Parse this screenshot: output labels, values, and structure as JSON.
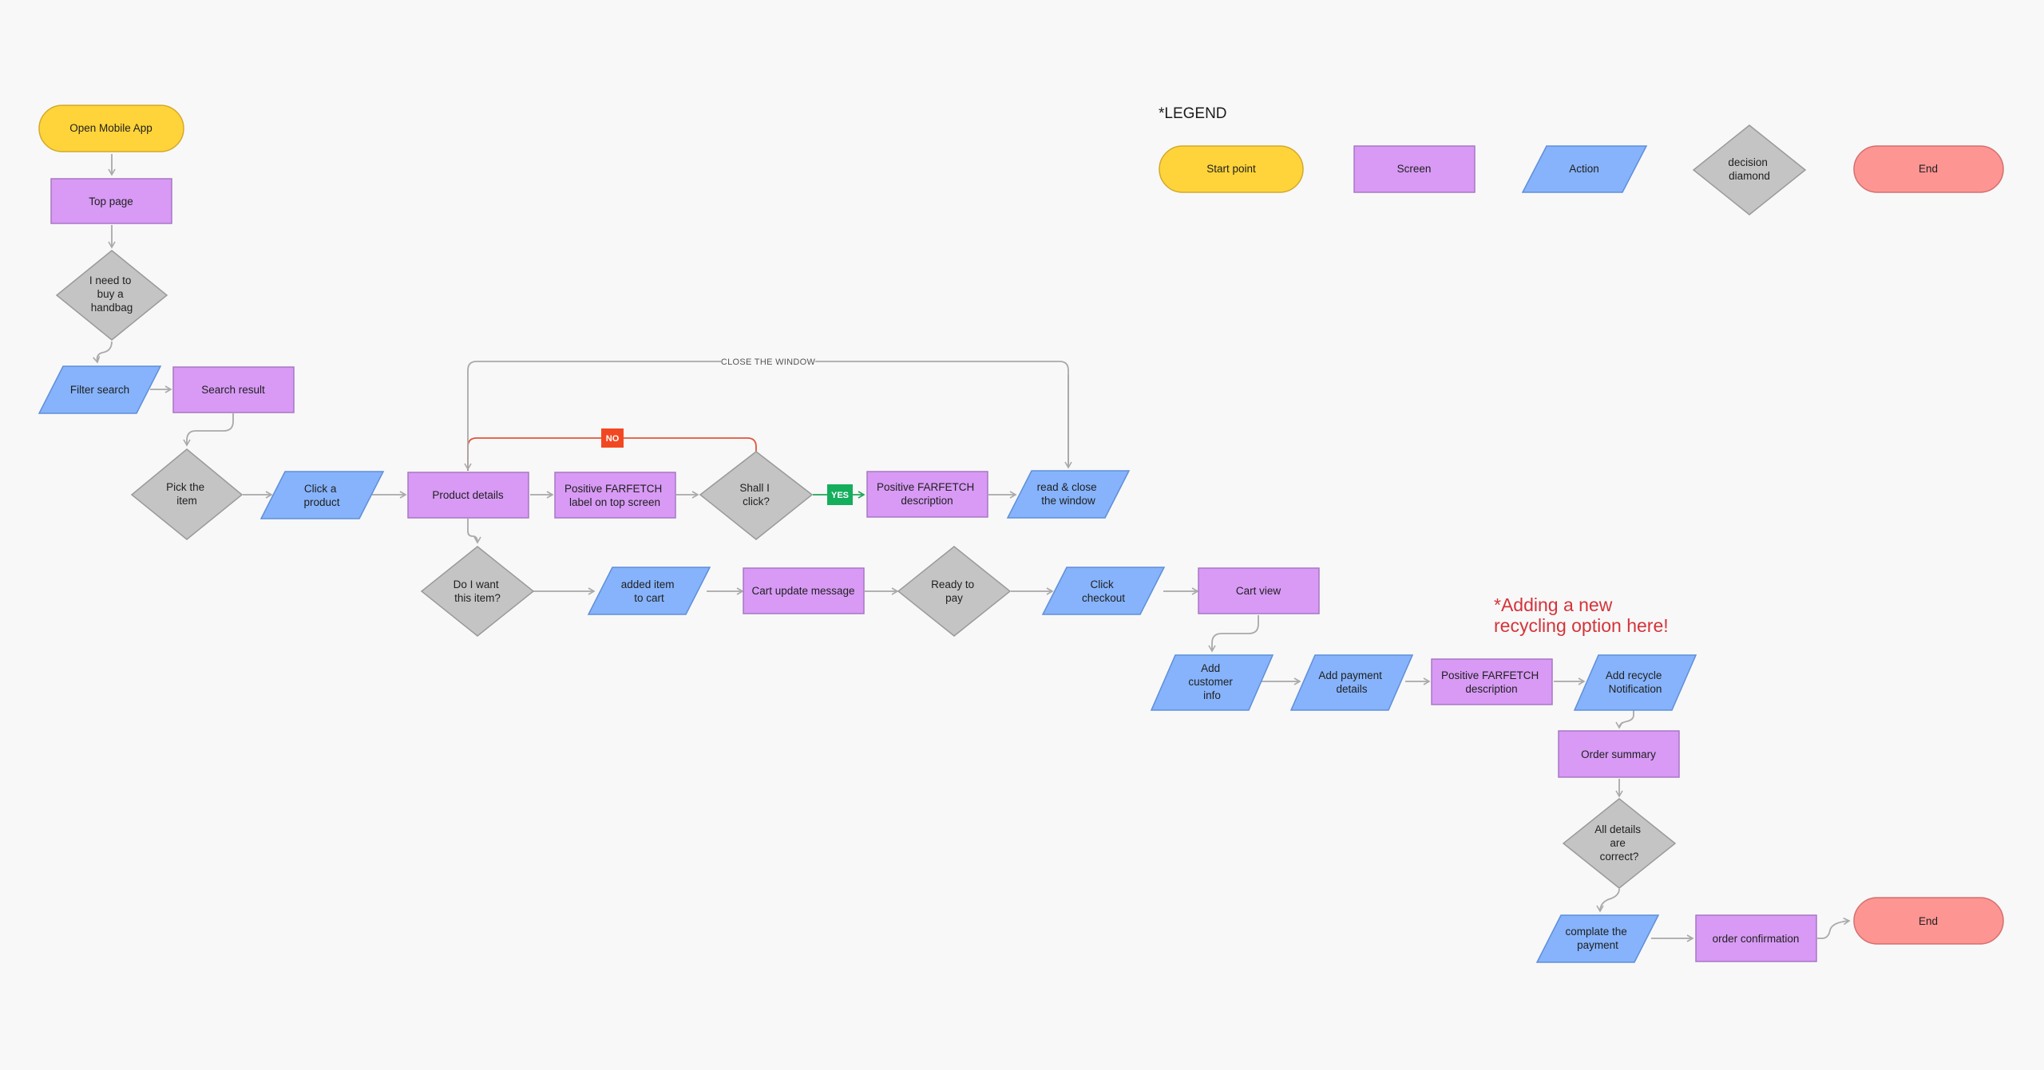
{
  "legend": {
    "title": "*LEGEND",
    "start": "Start point",
    "screen": "Screen",
    "action": "Action",
    "decision": "decision diamond",
    "end": "End"
  },
  "note": {
    "line1": "*Adding a new",
    "line2": "recycling option here!"
  },
  "colors": {
    "start": "#ffd43a",
    "screen": "#d89af5",
    "action": "#86b3fb",
    "decision": "#c4c4c4",
    "end": "#fd9593",
    "no_tag": "#f24822",
    "yes_tag": "#14ae5c",
    "note": "#d4343a"
  },
  "nodes": {
    "open_app": "Open Mobile App",
    "top_page": "Top page",
    "need_handbag": "I need to buy a handbag",
    "filter_search": "Filter search",
    "search_result": "Search result",
    "pick_item": "Pick the item",
    "click_product": "Click a product",
    "product_details": "Product details",
    "positive_label": "Positive FARFETCH label on top screen",
    "shall_click": "Shall I click?",
    "positive_desc_1": "Positive FARFETCH description",
    "read_close": "read & close the window",
    "want_item": "Do I want this item?",
    "added_cart": "added item to cart",
    "cart_update": "Cart update message",
    "ready_pay": "Ready to pay",
    "click_checkout": "Click checkout",
    "cart_view": "Cart view",
    "customer_info": "Add customer info",
    "payment_details": "Add payment details",
    "positive_desc_2": "Positive FARFETCH description",
    "recycle_notif": "Add recycle Notification",
    "order_summary": "Order summary",
    "details_correct": "All details are correct?",
    "complete_payment": "complate the payment",
    "order_confirm": "order confirmation",
    "end": "End"
  },
  "edges": {
    "close_window": "CLOSE THE WINDOW",
    "no": "NO",
    "yes": "YES"
  }
}
